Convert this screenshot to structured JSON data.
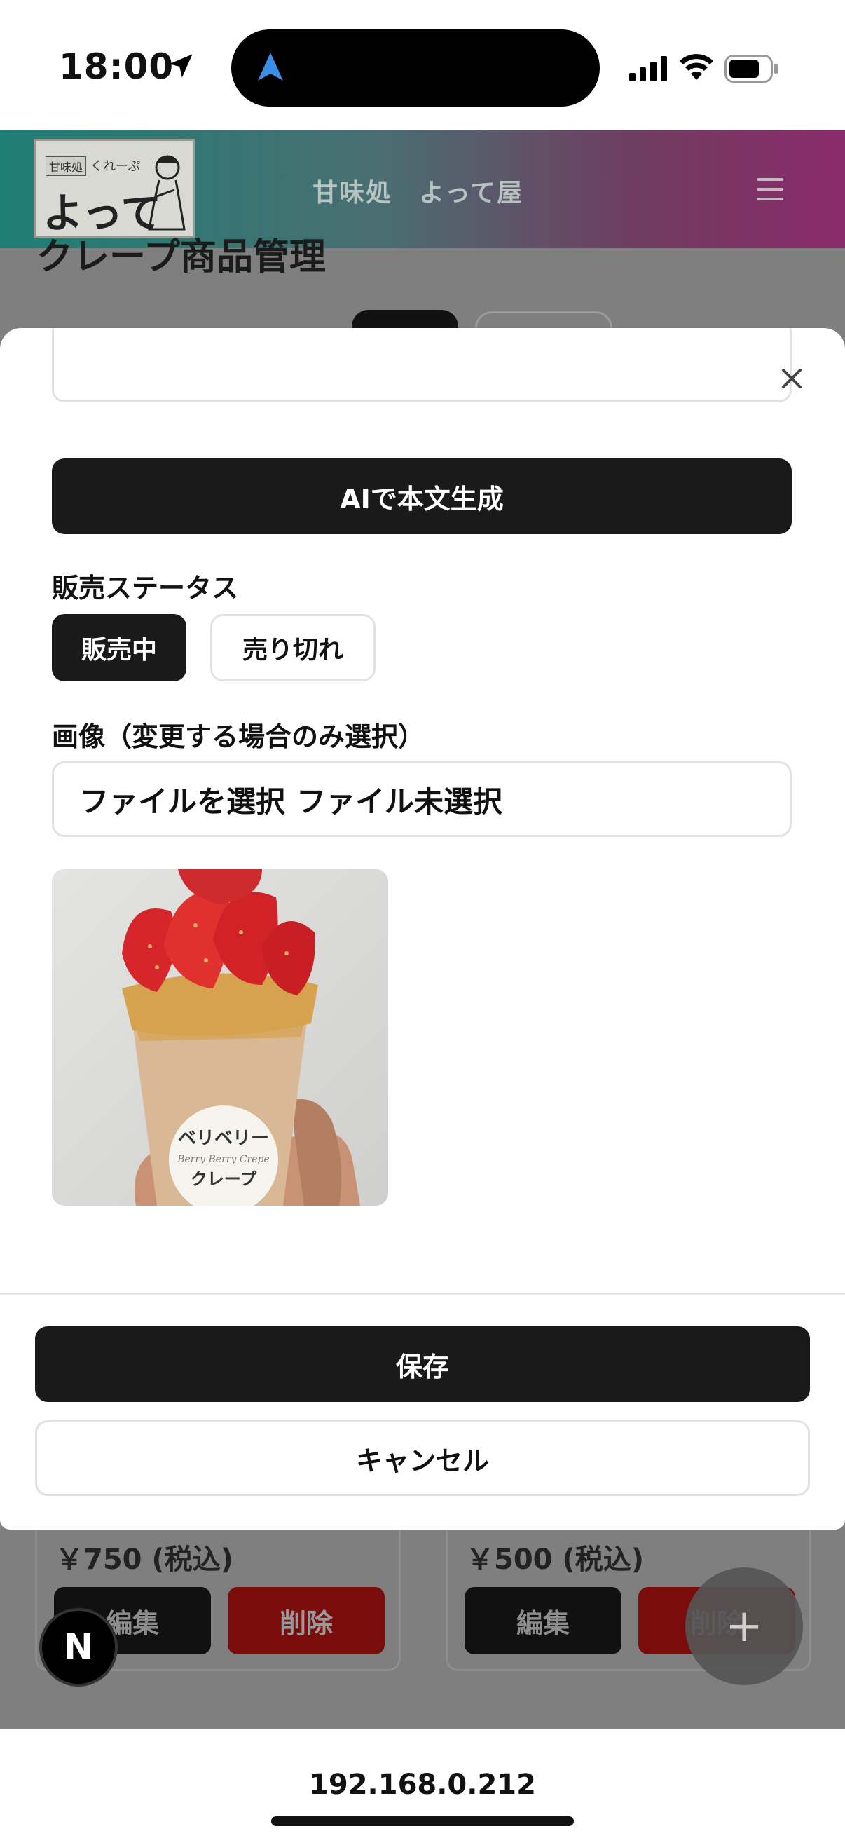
{
  "status_bar": {
    "time": "18:00"
  },
  "app_header": {
    "logo": {
      "badge": "甘味処",
      "sub": "くれーぷ",
      "main": "よって屋"
    },
    "brand_title": "甘味処　よって屋"
  },
  "page": {
    "title": "クレープ商品管理",
    "cards": [
      {
        "price": "￥750 (税込)",
        "edit_label": "編集",
        "delete_label": "削除"
      },
      {
        "price": "￥500 (税込)",
        "edit_label": "編集",
        "delete_label": "削除"
      }
    ],
    "fab_symbol": "+",
    "dev_badge": "N"
  },
  "modal": {
    "ai_button": "AIで本文生成",
    "status_label": "販売ステータス",
    "status_options": [
      "販売中",
      "売り切れ"
    ],
    "status_selected": "販売中",
    "image_label": "画像（変更する場合のみ選択）",
    "file_button": "ファイルを選択",
    "file_status": "ファイル未選択",
    "preview_label": {
      "line1": "ベリベリー",
      "line2": "Berry Berry Crepe",
      "line3": "クレープ"
    },
    "save_button": "保存",
    "cancel_button": "キャンセル"
  },
  "browser": {
    "url": "192.168.0.212"
  },
  "colors": {
    "primary_button": "#1a1a1a",
    "danger": "#c00000",
    "header_gradient_start": "#1e7f74",
    "header_gradient_end": "#8a2a6a",
    "ios_location_blue": "#3a8ee6"
  }
}
